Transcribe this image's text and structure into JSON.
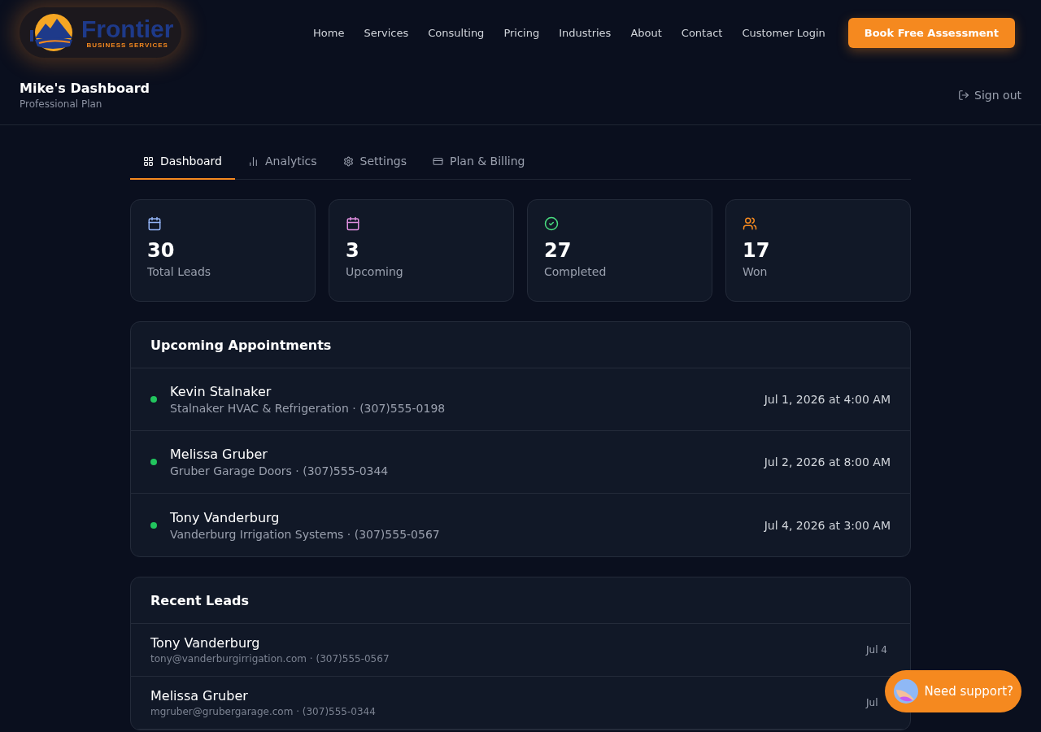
{
  "header": {
    "logo": {
      "name": "Frontier",
      "tagline": "BUSINESS SERVICES"
    },
    "nav": [
      "Home",
      "Services",
      "Consulting",
      "Pricing",
      "Industries",
      "About",
      "Contact",
      "Customer Login"
    ],
    "cta": "Book Free Assessment"
  },
  "account": {
    "title": "Mike's Dashboard",
    "plan": "Professional Plan",
    "sign_out": "Sign out"
  },
  "tabs": [
    {
      "label": "Dashboard",
      "kind": "grid",
      "selected": true
    },
    {
      "label": "Analytics",
      "kind": "chart",
      "selected": false
    },
    {
      "label": "Settings",
      "kind": "gear",
      "selected": false
    },
    {
      "label": "Plan & Billing",
      "kind": "card",
      "selected": false
    }
  ],
  "stats": [
    {
      "value": "30",
      "label": "Total Leads",
      "kind": "calendar",
      "color": "#93b4f5"
    },
    {
      "value": "3",
      "label": "Upcoming",
      "kind": "calendar",
      "color": "#e08fe0"
    },
    {
      "value": "27",
      "label": "Completed",
      "kind": "check",
      "color": "#4ade80"
    },
    {
      "value": "17",
      "label": "Won",
      "kind": "users",
      "color": "#f5891f"
    }
  ],
  "appointments": {
    "title": "Upcoming Appointments",
    "items": [
      {
        "name": "Kevin Stalnaker",
        "details": "Stalnaker HVAC & Refrigeration · (307)555-0198",
        "when": "Jul 1, 2026 at 4:00 AM",
        "color": "#22c55e"
      },
      {
        "name": "Melissa Gruber",
        "details": "Gruber Garage Doors · (307)555-0344",
        "when": "Jul 2, 2026 at 8:00 AM",
        "color": "#22c55e"
      },
      {
        "name": "Tony Vanderburg",
        "details": "Vanderburg Irrigation Systems · (307)555-0567",
        "when": "Jul 4, 2026 at 3:00 AM",
        "color": "#22c55e"
      }
    ]
  },
  "recent_leads": {
    "title": "Recent Leads",
    "items": [
      {
        "name": "Tony Vanderburg",
        "details": "tony@vanderburgirrigation.com · (307)555-0567",
        "date": "Jul 4"
      },
      {
        "name": "Melissa Gruber",
        "details": "mgruber@grubergarage.com · (307)555-0344",
        "date": "Jul"
      }
    ]
  },
  "support": {
    "label": "Need support?"
  }
}
